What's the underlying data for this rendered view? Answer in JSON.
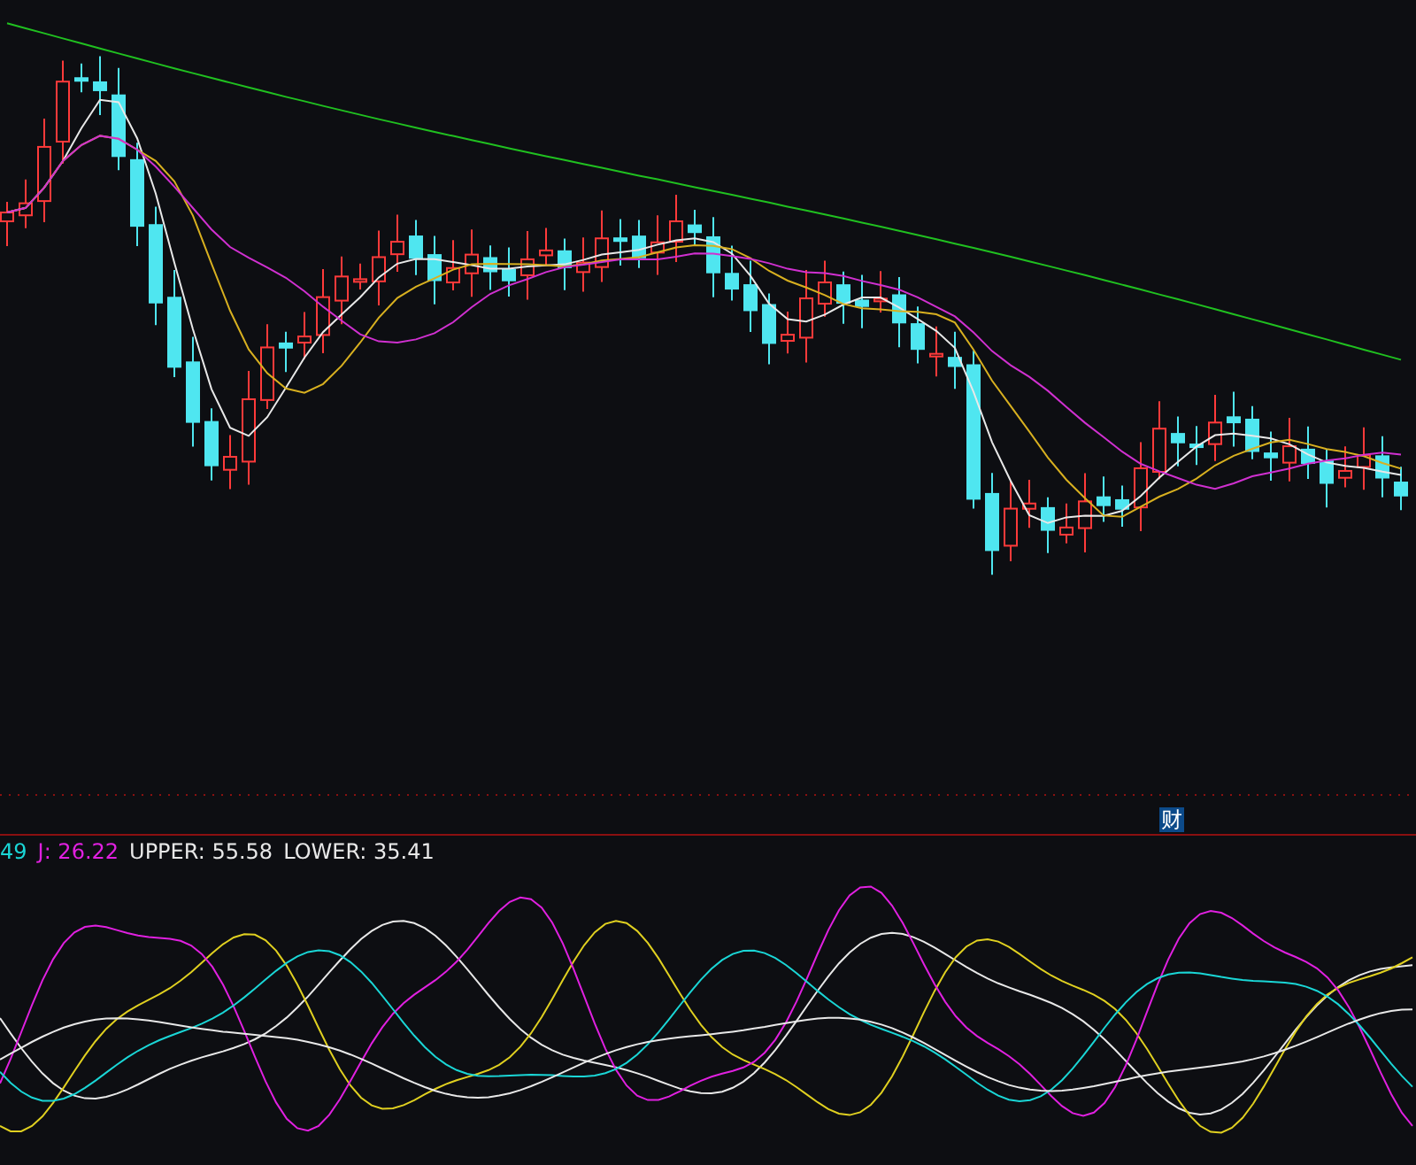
{
  "price_chart": {
    "badge": "财"
  },
  "indicator": {
    "legend": [
      {
        "text": "49",
        "color": "#1ad6d6"
      },
      {
        "text": "J: 26.22",
        "color": "#e020e0"
      },
      {
        "text": "UPPER: 55.58",
        "color": "#e8e8e8"
      },
      {
        "text": "LOWER: 35.41",
        "color": "#e8e8e8"
      }
    ]
  }
}
